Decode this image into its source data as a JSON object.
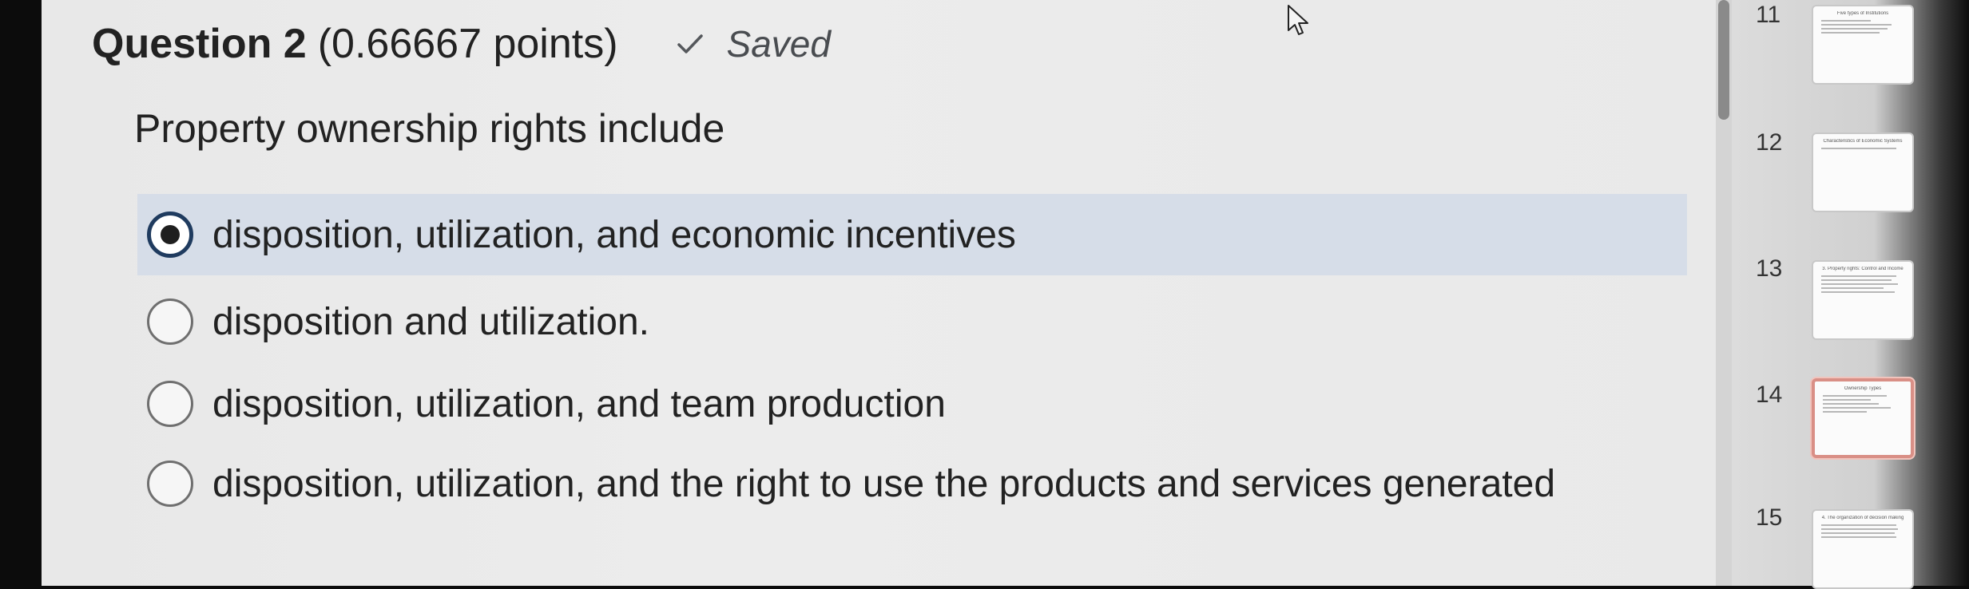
{
  "question": {
    "title": "Question 2",
    "points": "(0.66667 points)",
    "saved_label": "Saved",
    "prompt": "Property ownership rights include"
  },
  "options": [
    {
      "label": "disposition, utilization, and economic incentives",
      "selected": true
    },
    {
      "label": "disposition and utilization.",
      "selected": false
    },
    {
      "label": "disposition, utilization, and team production",
      "selected": false
    },
    {
      "label": "disposition, utilization, and the right to use the products and services generated",
      "selected": false
    }
  ],
  "sidebar": {
    "slides": [
      {
        "number": "11",
        "title": "Five types of Institutions"
      },
      {
        "number": "12",
        "title": "Characteristics of Economic Systems"
      },
      {
        "number": "13",
        "title": "3. Property rights: Control and Income"
      },
      {
        "number": "14",
        "title": "Ownership Types",
        "active": true
      },
      {
        "number": "15",
        "title": "4. The organization of decision making"
      }
    ]
  },
  "colors": {
    "selected_bg": "#d6dde8",
    "radio_checked_border": "#1f3b5f",
    "active_thumb_border": "#d98f86"
  }
}
